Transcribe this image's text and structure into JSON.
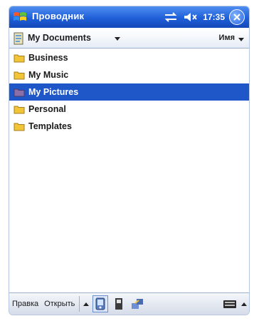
{
  "titlebar": {
    "app_title": "Проводник",
    "time": "17:35"
  },
  "folderbar": {
    "current_folder": "My Documents",
    "sort_label": "Имя"
  },
  "files": [
    {
      "name": "Business",
      "selected": false
    },
    {
      "name": "My Music",
      "selected": false
    },
    {
      "name": "My Pictures",
      "selected": true
    },
    {
      "name": "Personal",
      "selected": false
    },
    {
      "name": "Templates",
      "selected": false
    }
  ],
  "menubar": {
    "edit_label": "Правка",
    "open_label": "Открыть"
  },
  "colors": {
    "titlebar": "#1f5fd8",
    "selection": "#1f56c8",
    "folder": "#f2c437"
  },
  "icons": [
    "windows-start-icon",
    "sync-icon",
    "volume-icon",
    "close-icon",
    "documents-icon",
    "folder-icon",
    "view-toggle-icon",
    "storage-card-icon",
    "network-icon",
    "keyboard-icon"
  ]
}
